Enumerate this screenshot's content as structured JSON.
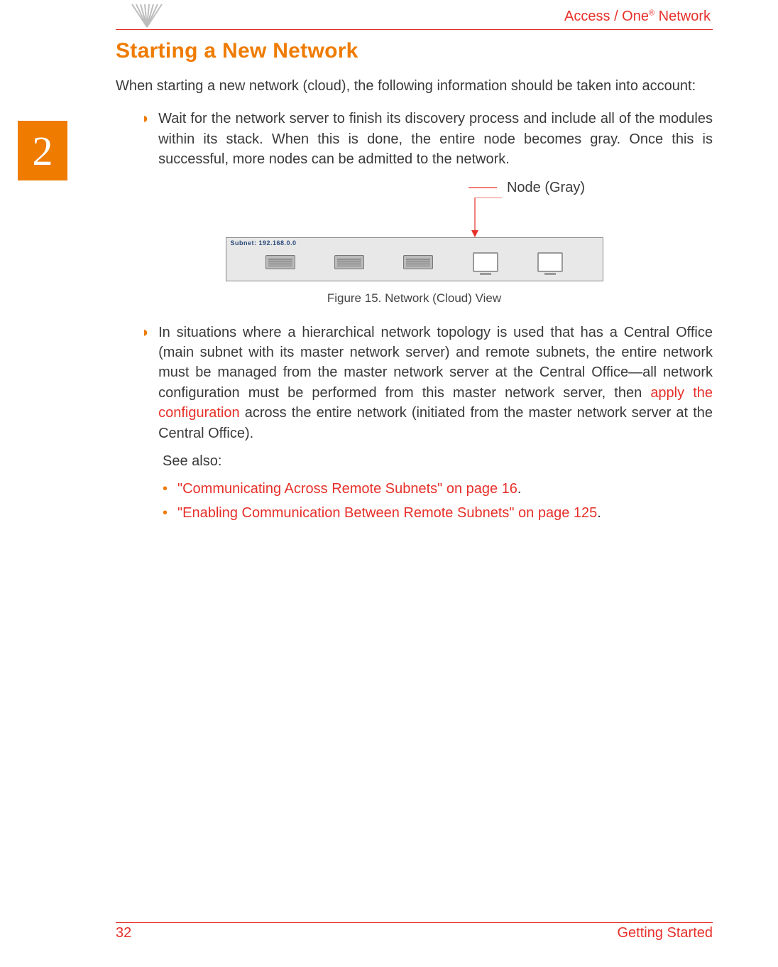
{
  "header": {
    "brand_prefix": "Access / One",
    "brand_reg": "®",
    "brand_suffix": " Network"
  },
  "chapter": {
    "number": "2"
  },
  "section": {
    "title": "Starting a New Network",
    "intro": "When starting a new network (cloud), the following information should be taken into account:"
  },
  "bullets": {
    "b1": "Wait for the network server to finish its discovery process and include all of the modules within its stack. When this is done, the entire node becomes gray. Once this is successful, more nodes can be admitted to the network.",
    "b2_pre": "In situations where a hierarchical network topology is used that has a Central Office (main subnet with its master network server) and remote subnets, the entire network must be managed from the master network server at the Central Office—all network configuration must be performed from this master network server, then ",
    "b2_link": "apply the configuration",
    "b2_post": " across the entire network (initiated from the master network server at the Central Office)."
  },
  "figure": {
    "callout": "Node (Gray)",
    "subnet_label": "Subnet: 192.168.0.0",
    "caption": "Figure 15. Network (Cloud) View"
  },
  "see_also": {
    "label": "See also:",
    "link1": "\"Communicating Across Remote Subnets\" on page 16",
    "dot1": ".",
    "link2": "\"Enabling Communication Between Remote Subnets\" on page 125",
    "dot2": "."
  },
  "footer": {
    "page": "32",
    "section": "Getting Started"
  }
}
